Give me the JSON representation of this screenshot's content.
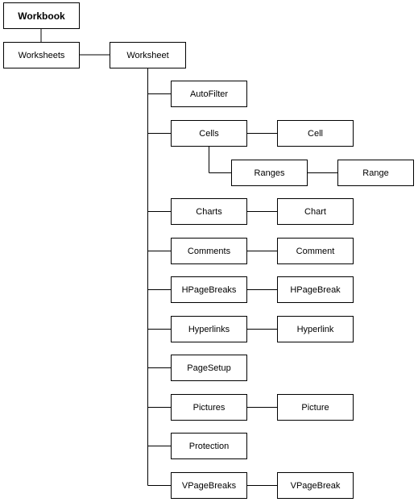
{
  "diagram": {
    "root": "Workbook",
    "collection": "Worksheets",
    "object": "Worksheet",
    "children": [
      {
        "label": "AutoFilter"
      },
      {
        "label": "Cells",
        "child": "Cell",
        "sub": {
          "label": "Ranges",
          "child": "Range"
        }
      },
      {
        "label": "Charts",
        "child": "Chart"
      },
      {
        "label": "Comments",
        "child": "Comment"
      },
      {
        "label": "HPageBreaks",
        "child": "HPageBreak"
      },
      {
        "label": "Hyperlinks",
        "child": "Hyperlink"
      },
      {
        "label": "PageSetup"
      },
      {
        "label": "Pictures",
        "child": "Picture"
      },
      {
        "label": "Protection"
      },
      {
        "label": "VPageBreaks",
        "child": "VPageBreak"
      }
    ]
  }
}
